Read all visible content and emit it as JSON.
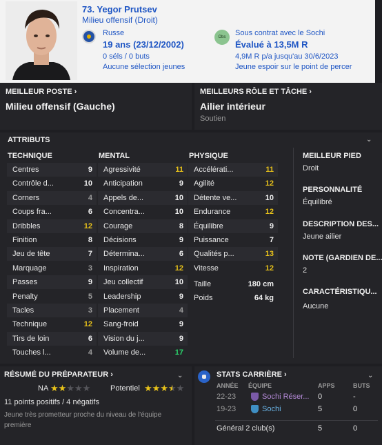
{
  "header": {
    "name": "73. Yegor Prutsev",
    "role": "Milieu offensif (Droit)",
    "nationality": "Russe",
    "age": "19 ans (23/12/2002)",
    "caps": "0 séls / 0 buts",
    "youth_caps": "Aucune sélection jeunes",
    "obs_badge": "Obs",
    "contract": "Sous contrat avec le Sochi",
    "value": "Évalué à 13,5M R",
    "wage": "4,9M R p/a jusqu'au 30/6/2023",
    "prospect": "Jeune espoir sur le point de percer"
  },
  "best_position": {
    "title": "MEILLEUR POSTE",
    "value": "Milieu offensif (Gauche)"
  },
  "best_role": {
    "title": "MEILLEURS RÔLE ET TÂCHE",
    "value": "Ailier intérieur",
    "duty": "Soutien"
  },
  "attributes": {
    "title": "ATTRIBUTS",
    "technical_title": "TECHNIQUE",
    "mental_title": "MENTAL",
    "physical_title": "PHYSIQUE",
    "technical": [
      {
        "label": "Centres",
        "value": "9",
        "tone": "white"
      },
      {
        "label": "Contrôle d...",
        "value": "10",
        "tone": "white"
      },
      {
        "label": "Corners",
        "value": "4",
        "tone": "grey"
      },
      {
        "label": "Coups fra...",
        "value": "6",
        "tone": "white"
      },
      {
        "label": "Dribbles",
        "value": "12",
        "tone": "yellow"
      },
      {
        "label": "Finition",
        "value": "8",
        "tone": "white"
      },
      {
        "label": "Jeu de tête",
        "value": "7",
        "tone": "white"
      },
      {
        "label": "Marquage",
        "value": "3",
        "tone": "grey"
      },
      {
        "label": "Passes",
        "value": "9",
        "tone": "white"
      },
      {
        "label": "Penalty",
        "value": "5",
        "tone": "grey"
      },
      {
        "label": "Tacles",
        "value": "3",
        "tone": "grey"
      },
      {
        "label": "Technique",
        "value": "12",
        "tone": "yellow"
      },
      {
        "label": "Tirs de loin",
        "value": "6",
        "tone": "white"
      },
      {
        "label": "Touches l...",
        "value": "4",
        "tone": "grey"
      }
    ],
    "mental": [
      {
        "label": "Agressivité",
        "value": "11",
        "tone": "yellow"
      },
      {
        "label": "Anticipation",
        "value": "9",
        "tone": "white"
      },
      {
        "label": "Appels de...",
        "value": "10",
        "tone": "white"
      },
      {
        "label": "Concentra...",
        "value": "10",
        "tone": "white"
      },
      {
        "label": "Courage",
        "value": "8",
        "tone": "white"
      },
      {
        "label": "Décisions",
        "value": "9",
        "tone": "white"
      },
      {
        "label": "Détermina...",
        "value": "6",
        "tone": "white"
      },
      {
        "label": "Inspiration",
        "value": "12",
        "tone": "yellow"
      },
      {
        "label": "Jeu collectif",
        "value": "10",
        "tone": "white"
      },
      {
        "label": "Leadership",
        "value": "9",
        "tone": "white"
      },
      {
        "label": "Placement",
        "value": "4",
        "tone": "grey"
      },
      {
        "label": "Sang-froid",
        "value": "9",
        "tone": "white"
      },
      {
        "label": "Vision du j...",
        "value": "9",
        "tone": "white"
      },
      {
        "label": "Volume de...",
        "value": "17",
        "tone": "green"
      }
    ],
    "physical": [
      {
        "label": "Accélérati...",
        "value": "11",
        "tone": "yellow"
      },
      {
        "label": "Agilité",
        "value": "12",
        "tone": "yellow"
      },
      {
        "label": "Détente ve...",
        "value": "10",
        "tone": "white"
      },
      {
        "label": "Endurance",
        "value": "12",
        "tone": "yellow"
      },
      {
        "label": "Équilibre",
        "value": "9",
        "tone": "white"
      },
      {
        "label": "Puissance",
        "value": "7",
        "tone": "white"
      },
      {
        "label": "Qualités p...",
        "value": "13",
        "tone": "yellow"
      },
      {
        "label": "Vitesse",
        "value": "12",
        "tone": "yellow"
      }
    ],
    "height_label": "Taille",
    "height_value": "180 cm",
    "weight_label": "Poids",
    "weight_value": "64 kg",
    "info": {
      "foot_title": "MEILLEUR PIED",
      "foot_value": "Droit",
      "personality_title": "PERSONNALITÉ",
      "personality_value": "Équilibré",
      "description_title": "DESCRIPTION DES...",
      "description_value": "Jeune ailier",
      "gk_title": "NOTE (GARDIEN DE...",
      "gk_value": "2",
      "traits_title": "CARACTÉRISTIQU...",
      "traits_value": "Aucune"
    }
  },
  "coach": {
    "title": "RÉSUMÉ DU PRÉPARATEUR",
    "ability_label": "NA",
    "ability_stars": 2,
    "potential_label": "Potentiel",
    "potential_stars": 3.5,
    "summary": "11 points positifs / 4 négatifs",
    "description": "Jeune très prometteur proche du niveau de l'équipe première"
  },
  "career": {
    "title": "STATS CARRIÈRE",
    "col_year": "ANNÉE",
    "col_team": "ÉQUIPE",
    "col_apps": "APPS",
    "col_goals": "BUTS",
    "rows": [
      {
        "year": "22-23",
        "team": "Sochi Réser...",
        "apps": "0",
        "goals": "-"
      },
      {
        "year": "19-23",
        "team": "Sochi",
        "apps": "5",
        "goals": "0"
      }
    ],
    "total_label": "Général 2 club(s)",
    "total_apps": "5",
    "total_goals": "0"
  },
  "colors": {
    "accent_blue": "#1f56c4",
    "attr_high": "#e8c21a",
    "attr_excellent": "#2bd46c",
    "attr_low": "#9a9a9a"
  }
}
